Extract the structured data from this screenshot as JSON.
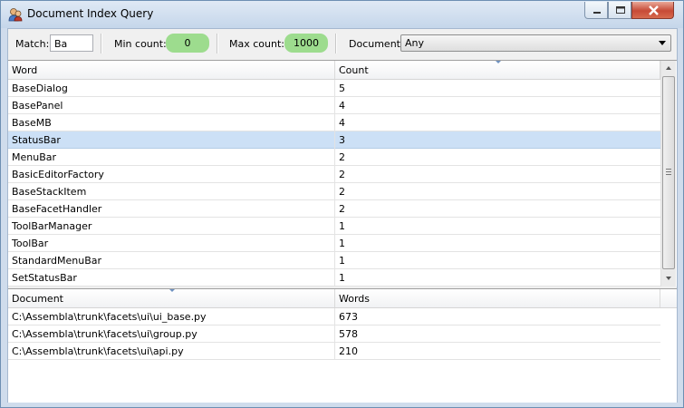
{
  "window": {
    "title": "Document Index Query"
  },
  "toolbar": {
    "match_label": "Match:",
    "match_value": "Ba",
    "min_label": "Min count:",
    "min_value": "0",
    "max_label": "Max count:",
    "max_value": "1000",
    "document_label": "Document:",
    "document_value": "Any"
  },
  "words_table": {
    "headers": [
      "Word",
      "Count"
    ],
    "rows": [
      [
        "BaseDialog",
        "5"
      ],
      [
        "BasePanel",
        "4"
      ],
      [
        "BaseMB",
        "4"
      ],
      [
        "StatusBar",
        "3"
      ],
      [
        "MenuBar",
        "2"
      ],
      [
        "BasicEditorFactory",
        "2"
      ],
      [
        "BaseStackItem",
        "2"
      ],
      [
        "BaseFacetHandler",
        "2"
      ],
      [
        "ToolBarManager",
        "1"
      ],
      [
        "ToolBar",
        "1"
      ],
      [
        "StandardMenuBar",
        "1"
      ],
      [
        "SetStatusBar",
        "1"
      ]
    ]
  },
  "docs_table": {
    "headers": [
      "Document",
      "Words"
    ],
    "rows": [
      [
        "C:\\Assembla\\trunk\\facets\\ui\\ui_base.py",
        "673"
      ],
      [
        "C:\\Assembla\\trunk\\facets\\ui\\group.py",
        "578"
      ],
      [
        "C:\\Assembla\\trunk\\facets\\ui\\api.py",
        "210"
      ]
    ]
  },
  "colors": {
    "selected_row": "#cce0f6",
    "pill": "#9ddc8e"
  }
}
